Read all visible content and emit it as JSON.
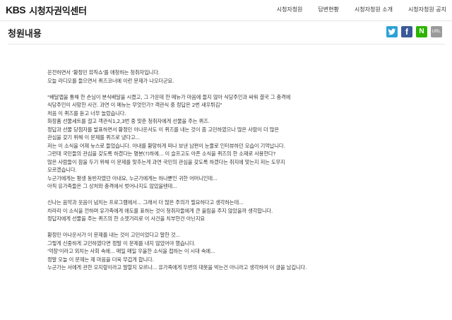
{
  "header": {
    "logo_text": "KBS",
    "site_name": "시청자권익센터",
    "nav": [
      "시청자청원",
      "답변현황",
      "시청자청원 소개",
      "시청자청원 공지"
    ]
  },
  "page": {
    "title": "청원내용"
  },
  "share": {
    "twitter_glyph": "🐦",
    "facebook_glyph": "f",
    "naver_glyph": "N",
    "url_label": "URL",
    "colors": {
      "twitter": "#2fa1d6",
      "facebook": "#3b5998",
      "naver": "#2db400",
      "url": "#9a9a9a"
    }
  },
  "content": {
    "lines": [
      "운전하면서 '황정민 뮤직쇼'를 애청하는 청취자입니다.",
      "오늘 라디오를 들으면서 퀴즈코너에 이런 문제가 나오더군요.",
      "",
      "\"배달앱을 통해 한 손님이 분식배달을 시켰고, 그 가운데 한 메뉴가 마음에 들지 않아 식당주인과 싸워 결국 그 충격에",
      "식당주인이 사망한 사건. 과연 이 메뉴는 무엇인가? 객관식 중 정답은 2번 새우튀김\"",
      "처음 이 퀴즈를 듣고 너무 놀랐습니다.",
      "화장품 선물세트를 걸고 객관식1,2,3번 중 맞춘 청취자에게 선물을 주는 퀴즈.",
      "정답과 선물 당첨자를 발표하면서 황정민 아나운서도 이 퀴즈를 내는 것이 좀 고민하였으나 많은 사람이 더 많은",
      "관심을 갖기 위해 이 문제를 퀴즈로 냈다고...",
      "저는 이 소식을 어제 뉴스로 들었습니다. 아내를 황망하게 떠나 보낸 남편이 눈물로 인터뷰하던 모습이 기억납니다.",
      "그런데 국민들의 관심을 갖도록 하겠다는 명분(?)하에... 이 슬프고도 아픈 소식을 퀴즈의 한 소재로 사용한다?",
      "많은 사람들이 참을 두기 위해 이 문제를 맞추는게 과연 국민의 관심을 갖도록 하겠다는 취지에 맞는지 저는 도무지",
      "모르겠습니다.",
      "누군가에게는 평생 동반자였던 아내요, 누군가에게는 하나뿐인 귀한 어머니인데...",
      "아직 유가족들은 그 상처와 충격에서 벗어나지도 않았을텐데...",
      "",
      "신나는 음악과 웃음이 넘치는 프로그램에서... 그래서 더 많은 주의가 필요하다고 생각하는데...",
      "차라리 이 소식을 전하며 유가족에게 애도를 표하는 것이 청취자들에게 큰 울림을 주지 않았을까 생각합니다.",
      "정답자에게 선물을 주는 퀴즈의 한 소잿거리로 이 사건을 치부한건 아닌지요",
      "",
      "황정민 아나운서가 이 문제를 내는 것이 고민이었다고 말한 것...",
      "그렇게 신중하게 고민하였다면 정말 이 문제를 내지 않았어야 했습니다.",
      "'억장'이라고 외치는 사회 속에... 매일 매일 우울한 소식을 접하는 이 시대 속에...",
      "정말 오늘 이 문제는 제 마음을 더욱 무겁게 합니다.",
      "누군가는 서에게 관한 오지랖이라고 말할지 모르나... 유가족에게 두번의 대못을 박는건 아니라고 생각하여 이 글을 남깁니다."
    ]
  }
}
